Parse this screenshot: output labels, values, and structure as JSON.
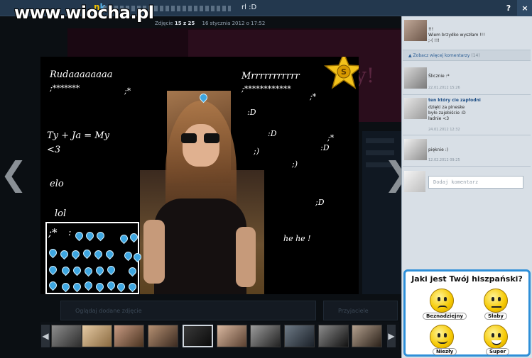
{
  "watermark": "www.wiocha.pl",
  "topbar": {
    "logo_n": "n",
    "logo_k": "k",
    "photo_title": "rl :D",
    "help": "?",
    "close": "×"
  },
  "photo_meta": {
    "counter_prefix": "Zdjęcie",
    "counter": "15 z 25",
    "date": "16 stycznia 2012 o 17:52"
  },
  "photo_text": {
    "name_left": "Rudaaaaaaaa",
    "stars_left": ";*******",
    "kiss_left": ";*",
    "ty_ja": "Ty + Ja = My",
    "heart": "<3",
    "elo": "elo",
    "lol": "lol",
    "name_right": "Mrrrrrrrrrrr",
    "stars_right": ";************",
    "kiss_right": ";*",
    "d1": ":D",
    "d2": ":D",
    "d3": ":D",
    "kiss3": ";*",
    "smile1": ";)",
    "smile2": ";)",
    "d4": ";D",
    "hehe": "he he !",
    "box_kiss": ";*",
    "box_colon": ":"
  },
  "background_page": {
    "tab1": "Oglądaj dodane zdjęcie",
    "tab2": "Przyjaciele",
    "pink_text": "y!"
  },
  "comments_panel": {
    "first_comment": {
      "text": "!!!\nWiem brzydko wyszłam !!!\n;-( !!!"
    },
    "more_comments_label": "Zobacz więcej komentarzy",
    "more_comments_count": "(14)",
    "comments": [
      {
        "author": "",
        "text": "Ślicznie :*",
        "date": "22.01.2012 15:26"
      },
      {
        "author": "ten który cie zapłodni",
        "text": "dzięki za pineske\nbyło zajebiście :D\nładnie <3",
        "date": "24.01.2012 12:32"
      },
      {
        "author": "",
        "text": "pięknie :)",
        "date": "12.02.2012 09:25"
      }
    ],
    "add_comment_placeholder": "Dodaj komentarz"
  },
  "ad": {
    "title": "Jaki jest Twój hiszpański?",
    "options": [
      "Beznadziejny",
      "Słaby",
      "Niezły",
      "Super"
    ]
  }
}
